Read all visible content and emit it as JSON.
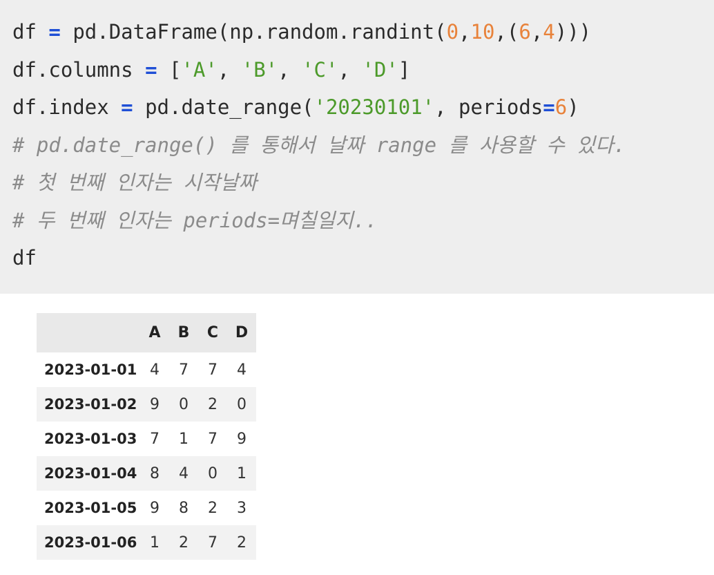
{
  "code": {
    "line1": {
      "a": "df ",
      "op": "=",
      "b": " pd.DataFrame(np.random.randint(",
      "n1": "0",
      "c": ",",
      "n2": "10",
      "d": ",(",
      "n3": "6",
      "e": ",",
      "n4": "4",
      "f": ")))"
    },
    "line2": {
      "a": "df.columns ",
      "op": "=",
      "b": " [",
      "s1": "'A'",
      "c": ", ",
      "s2": "'B'",
      "d": ", ",
      "s3": "'C'",
      "e": ", ",
      "s4": "'D'",
      "f": "]"
    },
    "line3": {
      "a": "df.index ",
      "op": "=",
      "b": " pd.date_range(",
      "s1": "'20230101'",
      "c": ", periods",
      "op2": "=",
      "n1": "6",
      "d": ")"
    },
    "comment1": "# pd.date_range() 를 통해서 날짜 range 를 사용할 수 있다.",
    "comment2": "# 첫 번째 인자는 시작날짜",
    "comment3": "# 두 번째 인자는 periods=며칠일지..",
    "line7": "df"
  },
  "table": {
    "columns": [
      "A",
      "B",
      "C",
      "D"
    ],
    "rows": [
      {
        "index": "2023-01-01",
        "values": [
          "4",
          "7",
          "7",
          "4"
        ]
      },
      {
        "index": "2023-01-02",
        "values": [
          "9",
          "0",
          "2",
          "0"
        ]
      },
      {
        "index": "2023-01-03",
        "values": [
          "7",
          "1",
          "7",
          "9"
        ]
      },
      {
        "index": "2023-01-04",
        "values": [
          "8",
          "4",
          "0",
          "1"
        ]
      },
      {
        "index": "2023-01-05",
        "values": [
          "9",
          "8",
          "2",
          "3"
        ]
      },
      {
        "index": "2023-01-06",
        "values": [
          "1",
          "2",
          "7",
          "2"
        ]
      }
    ]
  }
}
